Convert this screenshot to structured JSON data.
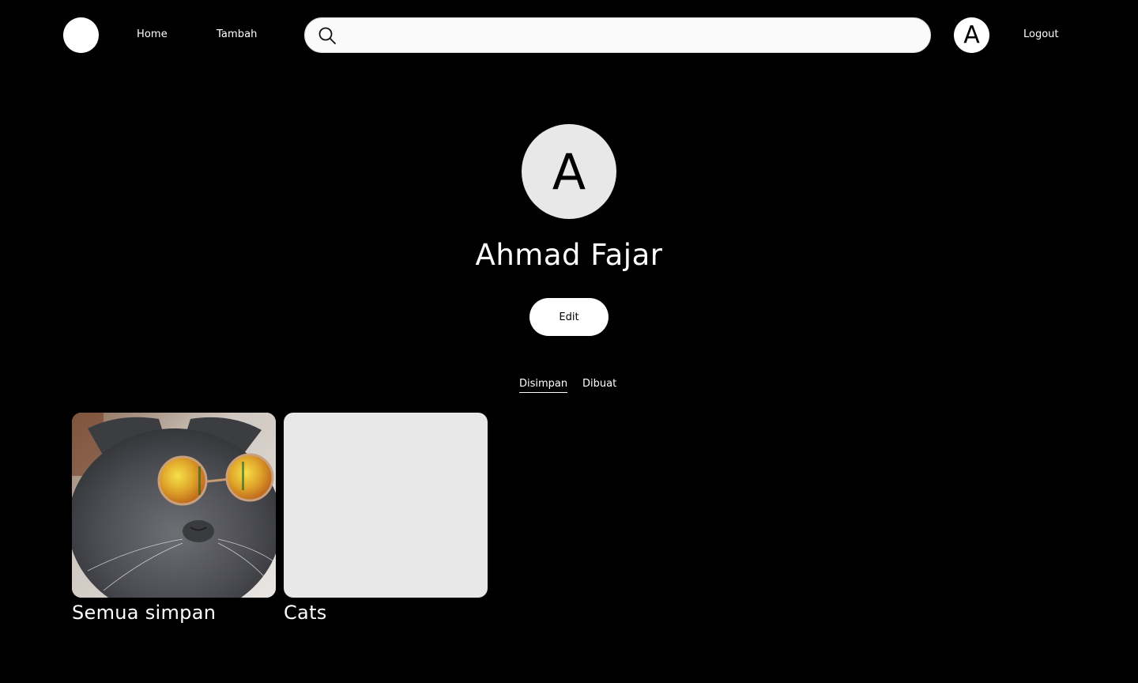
{
  "header": {
    "nav": {
      "home": "Home",
      "tambah": "Tambah"
    },
    "search": {
      "placeholder": "",
      "value": ""
    },
    "user_initial": "A",
    "logout": "Logout"
  },
  "profile": {
    "initial": "A",
    "name": "Ahmad Fajar",
    "edit_label": "Edit"
  },
  "tabs": [
    {
      "label": "Disimpan",
      "active": true
    },
    {
      "label": "Dibuat",
      "active": false
    }
  ],
  "boards": [
    {
      "title": "Semua simpan",
      "thumbnail": "cat-with-sunglasses-photo"
    },
    {
      "title": "Cats",
      "thumbnail": "empty"
    }
  ],
  "colors": {
    "background": "#000000",
    "surface": "#ffffff",
    "placeholder": "#e8e8e8"
  }
}
